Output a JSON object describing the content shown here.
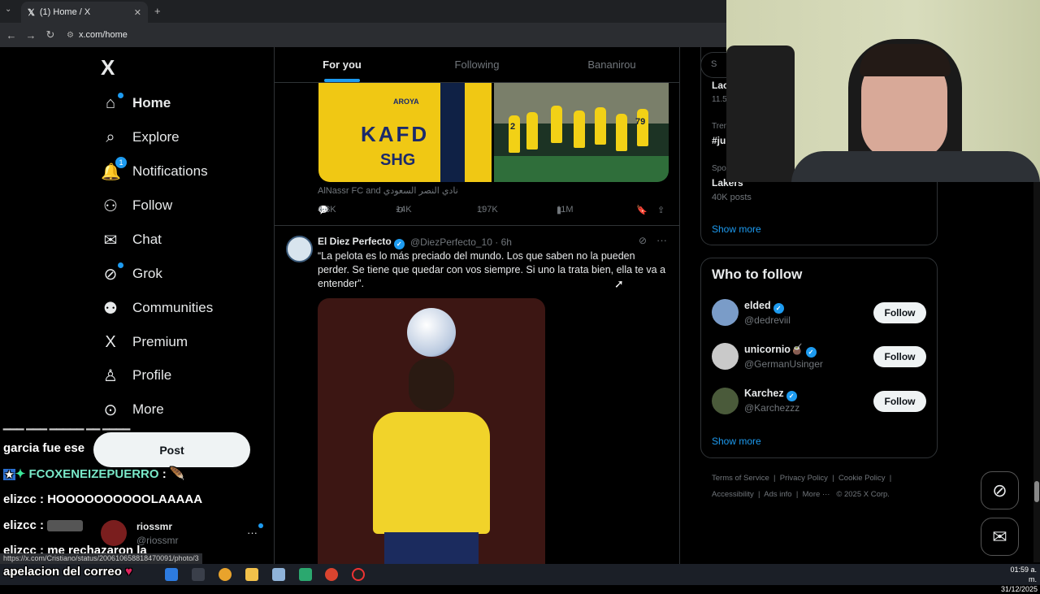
{
  "browser": {
    "tab_title": "(1) Home / X",
    "url": "x.com/home",
    "status_url": "https://x.com/Cristiano/status/200610658818470091/photo/3"
  },
  "nav": {
    "logo": "X",
    "items": [
      {
        "label": "Home",
        "icon": "home-icon",
        "glyph": "⌂"
      },
      {
        "label": "Explore",
        "icon": "search-icon",
        "glyph": "⌕"
      },
      {
        "label": "Notifications",
        "icon": "bell-icon",
        "glyph": "🔔",
        "badge": "1"
      },
      {
        "label": "Follow",
        "icon": "person-plus-icon",
        "glyph": "⚇"
      },
      {
        "label": "Chat",
        "icon": "mail-icon",
        "glyph": "✉"
      },
      {
        "label": "Grok",
        "icon": "grok-icon",
        "glyph": "⊘"
      },
      {
        "label": "Communities",
        "icon": "communities-icon",
        "glyph": "⚉"
      },
      {
        "label": "Premium",
        "icon": "x-premium-icon",
        "glyph": "X"
      },
      {
        "label": "Profile",
        "icon": "profile-icon",
        "glyph": "♙"
      },
      {
        "label": "More",
        "icon": "more-circle-icon",
        "glyph": "⊙"
      }
    ],
    "post_label": "Post",
    "account_name": "riossmr",
    "account_handle": "@riossmr"
  },
  "stream_chat": [
    {
      "user": "garcia fue ese",
      "msg": ""
    },
    {
      "user": "FCOXENEIZEPUERRO",
      "msg": ":"
    },
    {
      "user": "elizcc",
      "msg": ": HOOOOOOOOOOLAAAAA"
    },
    {
      "user": "elizcc",
      "msg": ":"
    },
    {
      "user": "elizcc",
      "msg": ": me rechazaron la"
    },
    {
      "user": "apelacion del correo",
      "msg": ""
    }
  ],
  "feed": {
    "tabs": [
      "For you",
      "Following",
      "Bananirou"
    ],
    "prev_post": {
      "caption": "AlNassr FC and نادي النصر السعودي",
      "kit_text_1": "KAFD",
      "kit_text_2": "SHG",
      "kit_text_3": "AROYA",
      "jersey_numbers": [
        "2",
        "79"
      ],
      "replies": "4.3K",
      "reposts": "14K",
      "likes": "197K",
      "views": "11M"
    },
    "post": {
      "name": "El Diez Perfecto",
      "handle": "@DiezPerfecto_10",
      "time": "· 6h",
      "text": "“La pelota es lo más preciado del mundo. Los que saben no la pueden perder. Se tiene que quedar con vos siempre. Si uno la trata bien, ella te va a entender”."
    }
  },
  "sidebar": {
    "search_placeholder": "S",
    "trends": [
      {
        "label": "Lac",
        "sub": "11.5"
      },
      {
        "label": "#ju",
        "sub": "Tren"
      },
      {
        "category": "Spo",
        "label": "Lakers",
        "sub": "40K posts"
      }
    ],
    "show_more": "Show more",
    "who_to_follow": {
      "title": "Who to follow",
      "users": [
        {
          "name": "elded",
          "handle": "@dedreviil",
          "button": "Follow",
          "verified": true
        },
        {
          "name": "unicornio🧉",
          "handle": "@GermanUsinger",
          "button": "Follow",
          "verified": true
        },
        {
          "name": "Karchez",
          "handle": "@Karchezzz",
          "button": "Follow",
          "verified": true
        }
      ],
      "show_more": "Show more"
    },
    "footer": [
      "Terms of Service",
      "Privacy Policy",
      "Cookie Policy",
      "Accessibility",
      "Ads info",
      "More ···",
      "© 2025 X Corp."
    ]
  },
  "clock": {
    "time": "01:59 a. m.",
    "date": "31/12/2025"
  },
  "colors": {
    "accent": "#1d9bf0",
    "bg": "#000000",
    "border": "#2f3336",
    "muted": "#71767b"
  }
}
